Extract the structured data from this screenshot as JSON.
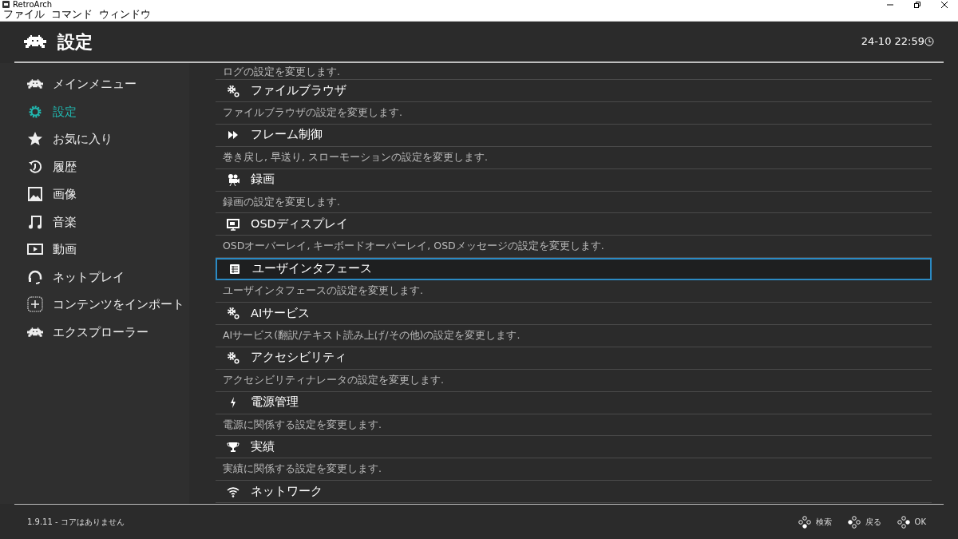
{
  "window": {
    "title": "RetroArch",
    "menu": [
      "ファイル",
      "コマンド",
      "ウィンドウ"
    ]
  },
  "header": {
    "title": "設定",
    "clock": "24-10 22:59"
  },
  "sidebar": {
    "items": [
      {
        "label": "メインメニュー",
        "selected": false
      },
      {
        "label": "設定",
        "selected": true
      },
      {
        "label": "お気に入り",
        "selected": false
      },
      {
        "label": "履歴",
        "selected": false
      },
      {
        "label": "画像",
        "selected": false
      },
      {
        "label": "音楽",
        "selected": false
      },
      {
        "label": "動画",
        "selected": false
      },
      {
        "label": "ネットプレイ",
        "selected": false
      },
      {
        "label": "コンテンツをインポート",
        "selected": false
      },
      {
        "label": "エクスプローラー",
        "selected": false
      }
    ]
  },
  "list": {
    "top_description": "ログの設定を変更します.",
    "items": [
      {
        "label": "ファイルブラウザ",
        "description": "ファイルブラウザの設定を変更します.",
        "selected": false
      },
      {
        "label": "フレーム制御",
        "description": "巻き戻し, 早送り, スローモーションの設定を変更します.",
        "selected": false
      },
      {
        "label": "録画",
        "description": "録画の設定を変更します.",
        "selected": false
      },
      {
        "label": "OSDディスプレイ",
        "description": "OSDオーバーレイ, キーボードオーバーレイ, OSDメッセージの設定を変更します.",
        "selected": false
      },
      {
        "label": "ユーザインタフェース",
        "description": "ユーザインタフェースの設定を変更します.",
        "selected": true
      },
      {
        "label": "AIサービス",
        "description": "AIサービス(翻訳/テキスト読み上げ/その他)の設定を変更します.",
        "selected": false
      },
      {
        "label": "アクセシビリティ",
        "description": "アクセシビリティナレータの設定を変更します.",
        "selected": false
      },
      {
        "label": "電源管理",
        "description": "電源に関係する設定を変更します.",
        "selected": false
      },
      {
        "label": "実績",
        "description": "実績に関係する設定を変更します.",
        "selected": false
      },
      {
        "label": "ネットワーク",
        "selected": false
      }
    ]
  },
  "footer": {
    "status": "1.9.11 - コアはありません",
    "buttons": [
      "検索",
      "戻る",
      "OK"
    ]
  }
}
